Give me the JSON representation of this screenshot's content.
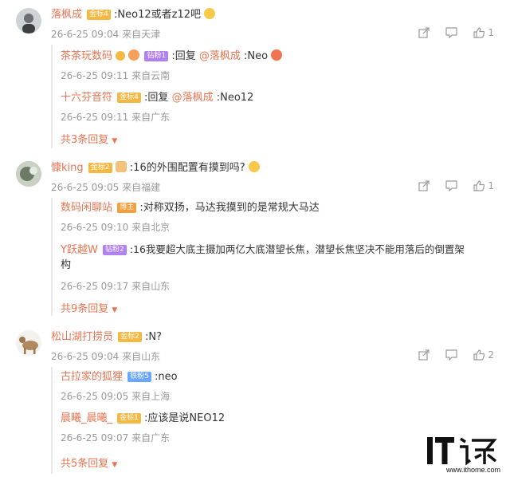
{
  "comments": [
    {
      "name": "落枫成",
      "badge": "金标4",
      "text": ":Neo12或者z12吧",
      "time": "26-6-25 09:04",
      "source": "来自天津",
      "likes": "1",
      "replies": [
        {
          "name": "茶茶玩数码",
          "badge": "钻粉1",
          "prefix": ":回复",
          "at": "@落枫成",
          "text": ":Neo",
          "time": "26-6-25 09:11",
          "source": "来自云南"
        },
        {
          "name": "十六芬音符",
          "badge": "金标4",
          "prefix": ":回复",
          "at": "@落枫成",
          "text": ":Neo12",
          "time": "26-6-25 09:11",
          "source": "来自广东"
        }
      ],
      "more": "共3条回复"
    },
    {
      "name": "慷king",
      "badge": "金标2",
      "text": ":16的外围配置有摸到吗?",
      "time": "26-6-25 09:05",
      "source": "来自福建",
      "likes": "1",
      "replies": [
        {
          "name": "数码闲聊站",
          "badge": "博主",
          "text": ":对称双扬，马达我摸到的是常规大马达",
          "time": "26-6-25 09:10",
          "source": "来自北京"
        },
        {
          "name": "Y跃越W",
          "badge": "钻粉2",
          "text": ":16我要超大底主摄加两亿大底潜望长焦，潜望长焦坚决不能用落后的倒置架",
          "text2": "构",
          "time": "26-6-25 09:17",
          "source": "来自山东"
        }
      ],
      "more": "共9条回复"
    },
    {
      "name": "松山湖打捞员",
      "badge": "金标2",
      "text": ":N?",
      "time": "26-6-25 09:04",
      "source": "来自山东",
      "likes": "2",
      "replies": [
        {
          "name": "古拉家的狐狸",
          "badge": "铁粉5",
          "text": ":neo",
          "time": "26-6-25 09:05",
          "source": "来自上海"
        },
        {
          "name": "晨曦_晨曦_",
          "badge": "金标1",
          "text": ":应该是说NEO12",
          "time": "26-6-25 09:07",
          "source": "来自广东"
        }
      ],
      "more": "共5条回复"
    }
  ],
  "watermark": {
    "logo": "IT之家",
    "url": "www.ithome.com"
  },
  "colors": {
    "name": "#eb7350",
    "meta": "#999999",
    "divider": "#e8e8e8"
  }
}
